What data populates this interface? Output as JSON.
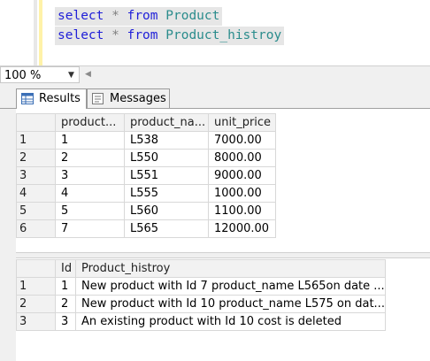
{
  "editor": {
    "lines": [
      {
        "kw1": "select",
        "star": "*",
        "kw2": "from",
        "table": "Product"
      },
      {
        "kw1": "select",
        "star": "*",
        "kw2": "from",
        "table": "Product_histroy"
      }
    ]
  },
  "zoom": {
    "value": "100 %"
  },
  "tabs": [
    {
      "label": "Results",
      "active": true,
      "icon": "grid-icon"
    },
    {
      "label": "Messages",
      "active": false,
      "icon": "messages-icon"
    }
  ],
  "grid1": {
    "columns": [
      "product...",
      "product_na...",
      "unit_price"
    ],
    "rows": [
      {
        "num": "1",
        "cells": [
          "1",
          "L538",
          "7000.00"
        ]
      },
      {
        "num": "2",
        "cells": [
          "2",
          "L550",
          "8000.00"
        ]
      },
      {
        "num": "3",
        "cells": [
          "3",
          "L551",
          "9000.00"
        ]
      },
      {
        "num": "4",
        "cells": [
          "4",
          "L555",
          "1000.00"
        ]
      },
      {
        "num": "5",
        "cells": [
          "5",
          "L560",
          "1100.00"
        ]
      },
      {
        "num": "6",
        "cells": [
          "7",
          "L565",
          "12000.00"
        ]
      }
    ]
  },
  "grid2": {
    "columns": [
      "Id",
      "Product_histroy"
    ],
    "rows": [
      {
        "num": "1",
        "cells": [
          "1",
          "New product with Id 7 product_name  L565on date ..."
        ]
      },
      {
        "num": "2",
        "cells": [
          "2",
          "New product with Id 10 product_name  L575 on dat..."
        ]
      },
      {
        "num": "3",
        "cells": [
          "3",
          "An existing product with Id 10 cost is deleted"
        ]
      }
    ]
  }
}
